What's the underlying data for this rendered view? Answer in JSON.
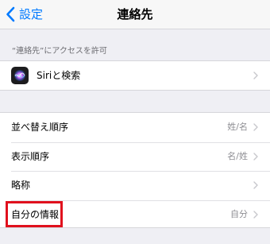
{
  "nav": {
    "back_label": "設定",
    "title": "連絡先"
  },
  "section_access": {
    "header": "“連絡先”にアクセスを許可",
    "rows": [
      {
        "label": "Siriと検索",
        "icon": "siri-icon"
      }
    ]
  },
  "section_settings": {
    "rows": [
      {
        "label": "並べ替え順序",
        "value": "姓/名"
      },
      {
        "label": "表示順序",
        "value": "名/姓"
      },
      {
        "label": "略称",
        "value": ""
      },
      {
        "label": "自分の情報",
        "value": "自分"
      }
    ]
  },
  "colors": {
    "accent": "#007aff",
    "highlight": "#e0101d",
    "background": "#efeff4"
  }
}
